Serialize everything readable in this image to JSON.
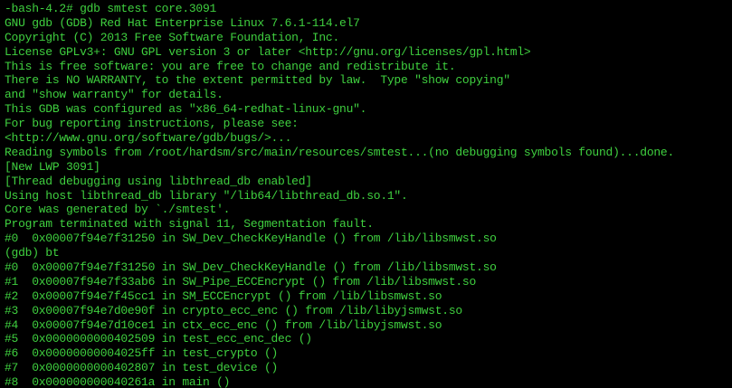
{
  "colors": {
    "background": "#000000",
    "text": "#3fd03f"
  },
  "terminal": {
    "lines": [
      "-bash-4.2# gdb smtest core.3091",
      "GNU gdb (GDB) Red Hat Enterprise Linux 7.6.1-114.el7",
      "Copyright (C) 2013 Free Software Foundation, Inc.",
      "License GPLv3+: GNU GPL version 3 or later <http://gnu.org/licenses/gpl.html>",
      "This is free software: you are free to change and redistribute it.",
      "There is NO WARRANTY, to the extent permitted by law.  Type \"show copying\"",
      "and \"show warranty\" for details.",
      "This GDB was configured as \"x86_64-redhat-linux-gnu\".",
      "For bug reporting instructions, please see:",
      "<http://www.gnu.org/software/gdb/bugs/>...",
      "Reading symbols from /root/hardsm/src/main/resources/smtest...(no debugging symbols found)...done.",
      "[New LWP 3091]",
      "[Thread debugging using libthread_db enabled]",
      "Using host libthread_db library \"/lib64/libthread_db.so.1\".",
      "Core was generated by `./smtest'.",
      "Program terminated with signal 11, Segmentation fault.",
      "#0  0x00007f94e7f31250 in SW_Dev_CheckKeyHandle () from /lib/libsmwst.so",
      "(gdb) bt",
      "#0  0x00007f94e7f31250 in SW_Dev_CheckKeyHandle () from /lib/libsmwst.so",
      "#1  0x00007f94e7f33ab6 in SW_Pipe_ECCEncrypt () from /lib/libsmwst.so",
      "#2  0x00007f94e7f45cc1 in SM_ECCEncrypt () from /lib/libsmwst.so",
      "#3  0x00007f94e7d0e90f in crypto_ecc_enc () from /lib/libyjsmwst.so",
      "#4  0x00007f94e7d10ce1 in ctx_ecc_enc () from /lib/libyjsmwst.so",
      "#5  0x0000000000402509 in test_ecc_enc_dec ()",
      "#6  0x00000000004025ff in test_crypto ()",
      "#7  0x0000000000402807 in test_device ()",
      "#8  0x000000000040261a in main ()"
    ]
  }
}
